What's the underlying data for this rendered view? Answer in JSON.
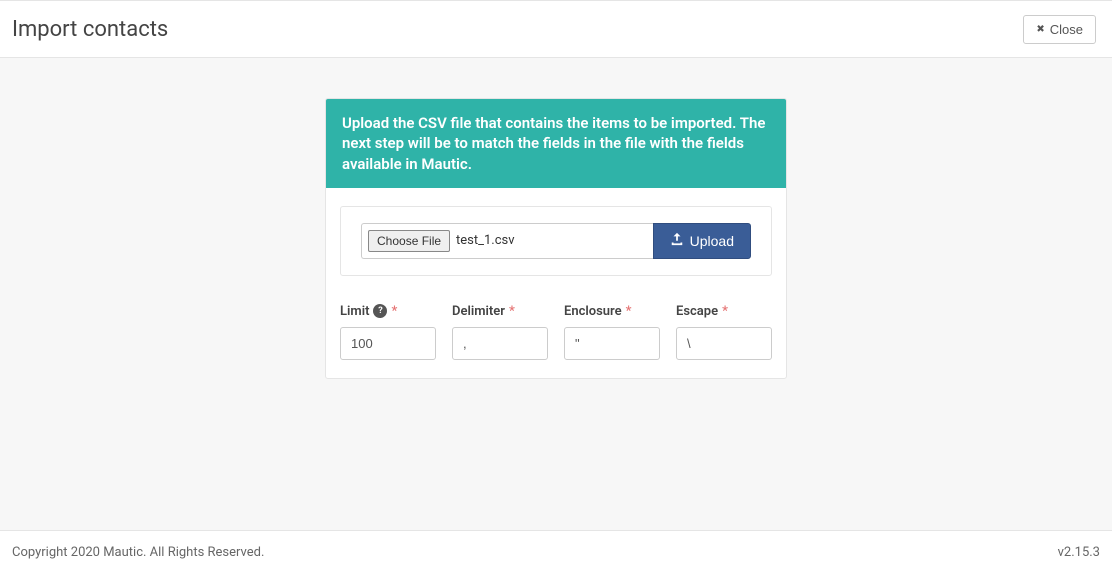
{
  "header": {
    "title": "Import contacts",
    "close_label": "Close"
  },
  "panel": {
    "instruction": "Upload the CSV file that contains the items to be imported. The next step will be to match the fields in the file with the fields available in Mautic.",
    "choose_file_label": "Choose File",
    "file_name": "test_1.csv",
    "upload_label": "Upload"
  },
  "fields": {
    "limit": {
      "label": "Limit",
      "value": "100"
    },
    "delimiter": {
      "label": "Delimiter",
      "value": ","
    },
    "enclosure": {
      "label": "Enclosure",
      "value": "\""
    },
    "escape": {
      "label": "Escape",
      "value": "\\"
    }
  },
  "footer": {
    "copyright": "Copyright 2020 Mautic. All Rights Reserved.",
    "version": "v2.15.3"
  }
}
